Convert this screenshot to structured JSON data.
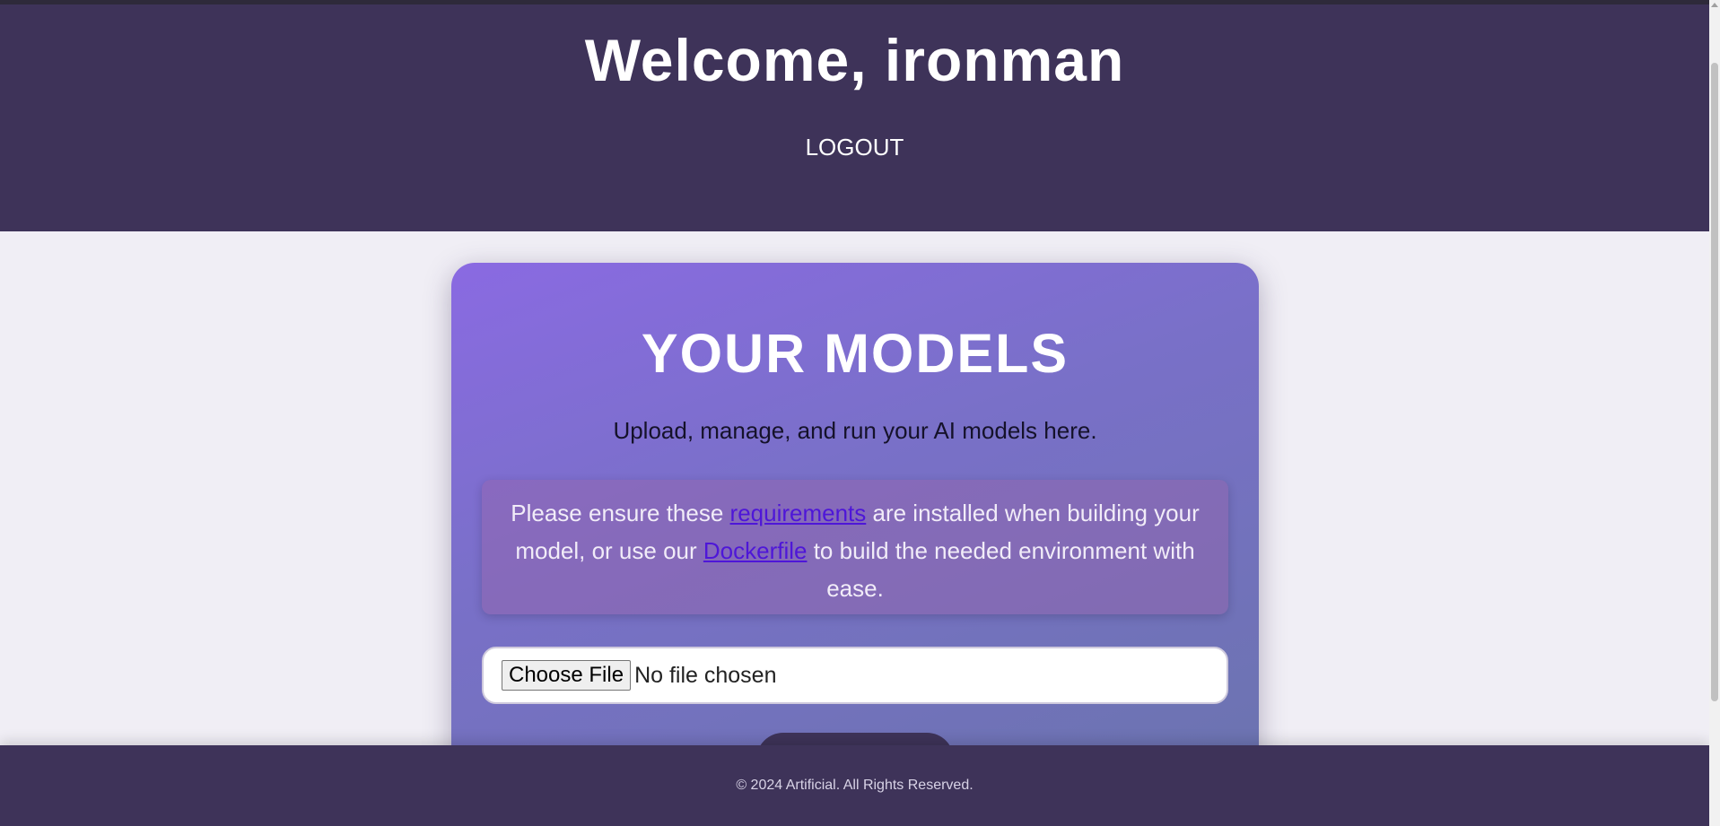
{
  "header": {
    "welcome_text": "Welcome, ironman",
    "logout_label": "LOGOUT"
  },
  "card": {
    "title": "YOUR MODELS",
    "subtitle": "Upload, manage, and run your AI models here.",
    "notice": {
      "part1": "Please ensure these ",
      "link1": "requirements",
      "part2": " are installed when building your model, or use our ",
      "link2": "Dockerfile",
      "part3": " to build the needed environment with ease."
    },
    "file_input": {
      "button_label": "Choose File",
      "status": "No file chosen"
    }
  },
  "footer": {
    "copyright": "© 2024 Artificial. All Rights Reserved."
  },
  "colors": {
    "header_bg": "#3e3359",
    "page_bg": "#f0eef5",
    "card_gradient_start": "#8a6ae2",
    "card_gradient_end": "#6a74ad",
    "link": "#4e16d8"
  }
}
